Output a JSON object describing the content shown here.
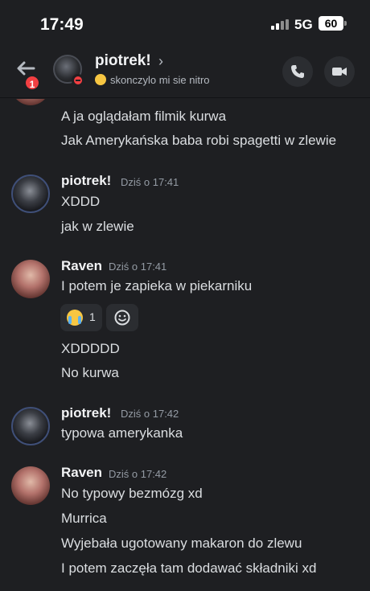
{
  "status_bar": {
    "time": "17:49",
    "network": "5G",
    "battery": "60"
  },
  "header": {
    "back_badge": "1",
    "channel_name": "piotrek!",
    "chevron": "›",
    "status_text": "skonczylo mi sie nitro"
  },
  "messages": [
    {
      "author": "",
      "time": "",
      "lines": [
        "A ja oglądałam filmik kurwa",
        "Jak Amerykańska baba robi spagetti w zlewie"
      ]
    },
    {
      "author": "piotrek!",
      "time": "Dziś o 17:41",
      "lines": [
        "XDDD",
        "jak w zlewie"
      ]
    },
    {
      "author": "Raven",
      "time": "Dziś o 17:41",
      "lines": [
        "I potem je zapieka w piekarniku",
        "XDDDDD",
        "No kurwa"
      ],
      "reaction": {
        "emoji": "sob-emoji",
        "count": "1"
      }
    },
    {
      "author": "piotrek!",
      "time": "Dziś o 17:42",
      "lines": [
        "typowa amerykanka"
      ]
    },
    {
      "author": "Raven",
      "time": "Dziś o 17:42",
      "lines": [
        "No typowy bezmózg xd",
        "Murrica",
        "Wyjebała ugotowany makaron do zlewu",
        "I potem zaczęła tam dodawać składniki xd"
      ]
    }
  ],
  "colors": {
    "background": "#1e1f22",
    "accent_red": "#f23f42",
    "reaction_bg": "#2b2d31"
  }
}
